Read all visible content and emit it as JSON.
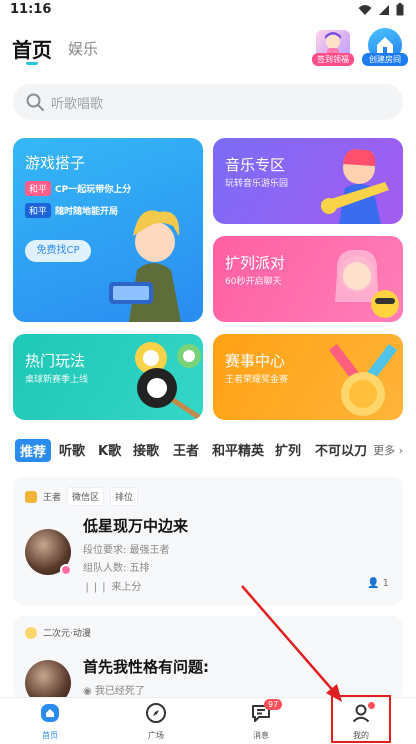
{
  "status_bar": {
    "time": "11:16"
  },
  "header": {
    "tab_home": "首页",
    "tab_entertainment": "娱乐",
    "sign_label": "签到领福",
    "create_room_label": "创建房间"
  },
  "search": {
    "placeholder": "听歌唱歌"
  },
  "cards": {
    "game": {
      "title": "游戏搭子",
      "row1_tag": "和平",
      "row1_text": "CP一起玩带你上分",
      "row2_tag": "和平",
      "row2_text": "随时随地能开局",
      "button": "免费找CP"
    },
    "music": {
      "title": "音乐专区",
      "sub": "玩转音乐游乐园"
    },
    "party": {
      "title": "扩列派对",
      "sub": "60秒开启聊天"
    },
    "hot": {
      "title": "热门玩法",
      "sub": "桌球新赛季上线"
    },
    "match": {
      "title": "赛事中心",
      "sub": "王者荣耀奖金赛"
    }
  },
  "categories": {
    "items": [
      "推荐",
      "听歌",
      "K歌",
      "接歌",
      "王者",
      "和平精英",
      "扩列",
      "不可以刀"
    ],
    "more": "更多"
  },
  "rooms": [
    {
      "tags": [
        "王者",
        "微信区",
        "排位"
      ],
      "title": "低星现万中边来",
      "line1": "段位要求: 最强王者",
      "line2": "组队人数: 五排",
      "line3": "来上分",
      "count": "1"
    },
    {
      "tags": [
        "二次元·动漫"
      ],
      "title": "首先我性格有问题:",
      "line1": "我已经死了"
    }
  ],
  "bottom_nav": {
    "home": "首页",
    "plaza": "广场",
    "messages": "消息",
    "messages_badge": "97",
    "mine": "我的"
  },
  "colors": {
    "accent": "#2b8cf0",
    "highlight": "#e02020"
  }
}
